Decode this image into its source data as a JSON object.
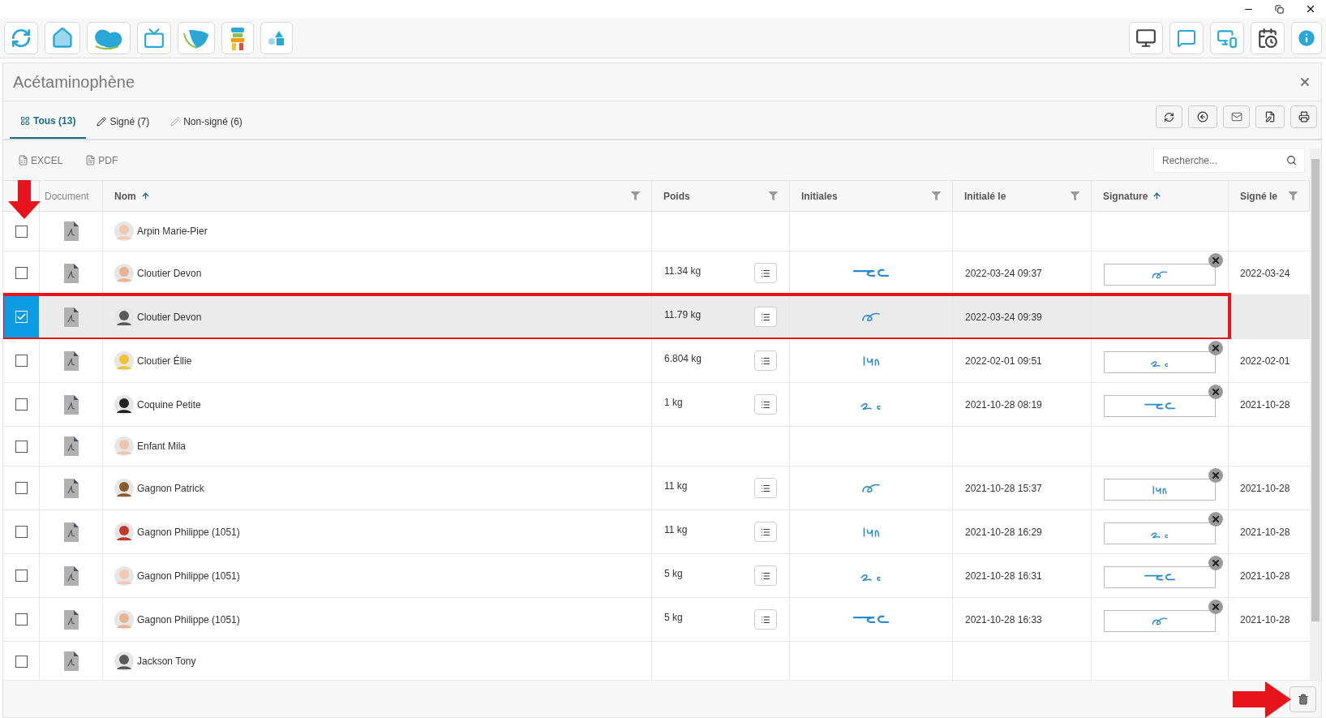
{
  "panel": {
    "title": "Acétaminophène"
  },
  "tabs": [
    {
      "label": "Tous (13)",
      "selected": true,
      "kind": "all"
    },
    {
      "label": "Signé (7)",
      "selected": false,
      "kind": "signed"
    },
    {
      "label": "Non-signé (6)",
      "selected": false,
      "kind": "unsigned"
    }
  ],
  "export_buttons": [
    {
      "label": "EXCEL",
      "kind": "excel"
    },
    {
      "label": "PDF",
      "kind": "pdf"
    }
  ],
  "search": {
    "placeholder": "Recherche..."
  },
  "table": {
    "columns": [
      {
        "label": "Document",
        "sorted": false,
        "filter": false,
        "kind": "plain"
      },
      {
        "label": "Nom",
        "sorted": true,
        "filter": true,
        "kind": "bold"
      },
      {
        "label": "Poids",
        "sorted": false,
        "filter": true,
        "kind": "bold"
      },
      {
        "label": "Initiales",
        "sorted": false,
        "filter": true,
        "kind": "bold"
      },
      {
        "label": "Initialé le",
        "sorted": false,
        "filter": true,
        "kind": "bold"
      },
      {
        "label": "Signature",
        "sorted": true,
        "filter": false,
        "kind": "bold"
      },
      {
        "label": "Signé le",
        "sorted": false,
        "filter": true,
        "kind": "bold"
      }
    ],
    "rows": [
      {
        "name": "Arpin Marie-Pier",
        "checked": false,
        "selected": false,
        "annotated": false,
        "initials": false,
        "signature": false
      },
      {
        "name": "Cloutier Devon",
        "checked": false,
        "selected": false,
        "annotated": false,
        "weight": "11.34 kg",
        "initials": true,
        "initialed_at": "2022-03-24 09:37",
        "signature": true,
        "signed_at": "2022-03-24"
      },
      {
        "name": "Cloutier Devon",
        "checked": true,
        "selected": true,
        "annotated": true,
        "weight": "11.79 kg",
        "initials": true,
        "initialed_at": "2022-03-24 09:39",
        "signature": false
      },
      {
        "name": "Cloutier Éllie",
        "checked": false,
        "selected": false,
        "annotated": false,
        "weight": "6.804 kg",
        "initials": true,
        "initialed_at": "2022-02-01 09:51",
        "signature": true,
        "signed_at": "2022-02-01"
      },
      {
        "name": "Coquine Petite",
        "checked": false,
        "selected": false,
        "annotated": false,
        "weight": "1 kg",
        "initials": true,
        "initialed_at": "2021-10-28 08:19",
        "signature": true,
        "signed_at": "2021-10-28"
      },
      {
        "name": "Enfant Mila",
        "checked": false,
        "selected": false,
        "annotated": false,
        "initials": false,
        "signature": false
      },
      {
        "name": "Gagnon Patrick",
        "checked": false,
        "selected": false,
        "annotated": false,
        "weight": "11 kg",
        "initials": true,
        "initialed_at": "2021-10-28 15:37",
        "signature": true,
        "signed_at": "2021-10-28"
      },
      {
        "name": "Gagnon Philippe (1051)",
        "checked": false,
        "selected": false,
        "annotated": false,
        "weight": "11 kg",
        "initials": true,
        "initialed_at": "2021-10-28 16:29",
        "signature": true,
        "signed_at": "2021-10-28"
      },
      {
        "name": "Gagnon Philippe (1051)",
        "checked": false,
        "selected": false,
        "annotated": false,
        "weight": "5 kg",
        "initials": true,
        "initialed_at": "2021-10-28 16:31",
        "signature": true,
        "signed_at": "2021-10-28"
      },
      {
        "name": "Gagnon Philippe (1051)",
        "checked": false,
        "selected": false,
        "annotated": false,
        "weight": "5 kg",
        "initials": true,
        "initialed_at": "2021-10-28 16:33",
        "signature": true,
        "signed_at": "2021-10-28"
      },
      {
        "name": "Jackson Tony",
        "checked": false,
        "selected": false,
        "annotated": false,
        "initials": false,
        "signature": false
      }
    ]
  }
}
